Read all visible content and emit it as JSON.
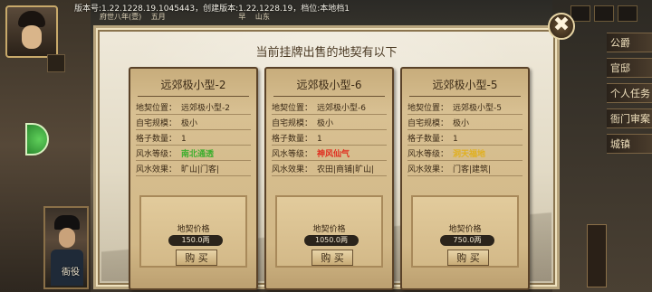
{
  "header": {
    "version_text": "版本号:1.22.1228.19.1045443，创建版本:1.22.1228.19，档位:本地档1",
    "date_items": [
      "府世八年(壹)",
      "五月",
      "早",
      "山东"
    ]
  },
  "dialog": {
    "title": "当前挂牌出售的地契有以下",
    "close_label": "✖"
  },
  "labels": {
    "location": "地契位置：",
    "scale": "自宅规模：",
    "grid_count": "格子数量：",
    "fengshui_level": "风水等级：",
    "fengshui_effect": "风水效果：",
    "price_title": "地契价格",
    "buy": "购 买"
  },
  "cards": [
    {
      "title": "远郊极小型-2",
      "location": "远郊极小型-2",
      "scale": "极小",
      "grid_count": "1",
      "fengshui_level": "南北通透",
      "fengshui_color": "#3fae2f",
      "fengshui_effect": "旷山|门客|",
      "price": "150.0两"
    },
    {
      "title": "远郊极小型-6",
      "location": "远郊极小型-6",
      "scale": "极小",
      "grid_count": "1",
      "fengshui_level": "神风仙气",
      "fengshui_color": "#e02a1c",
      "fengshui_effect": "农田|商铺|旷山|",
      "price": "1050.0两"
    },
    {
      "title": "远郊极小型-5",
      "location": "远郊极小型-5",
      "scale": "极小",
      "grid_count": "1",
      "fengshui_level": "洞天福地",
      "fengshui_color": "#e0b020",
      "fengshui_effect": "门客|建筑|",
      "price": "750.0两"
    }
  ],
  "right_menu": [
    "公爵",
    "官邸",
    "个人任务",
    "衙门审案",
    "城镇"
  ],
  "portrait": {
    "label": "衙役"
  },
  "colors": {
    "dialog_bg": "#e6dfcb",
    "card_bg": "#d4bb8a",
    "accent": "#5a4228"
  }
}
